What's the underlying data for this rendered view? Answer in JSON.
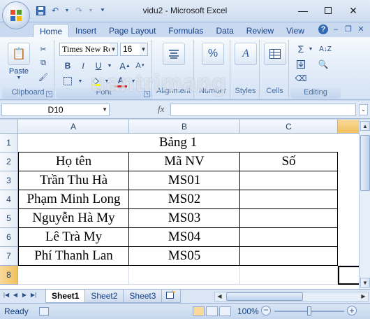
{
  "window": {
    "title": "vidu2 - Microsoft Excel"
  },
  "tabs": [
    "Home",
    "Insert",
    "Page Layout",
    "Formulas",
    "Data",
    "Review",
    "View"
  ],
  "ribbon": {
    "clipboard": {
      "label": "Clipboard",
      "paste": "Paste"
    },
    "font": {
      "label": "Font",
      "name": "Times New Ro",
      "size": "16",
      "bold": "B",
      "italic": "I",
      "underline": "U"
    },
    "alignment": {
      "label": "Alignment"
    },
    "number": {
      "label": "Number",
      "icon_text": "%"
    },
    "styles": {
      "label": "Styles"
    },
    "cells": {
      "label": "Cells"
    },
    "editing": {
      "label": "Editing",
      "sum": "Σ",
      "sort": "A↓Z"
    }
  },
  "formula_bar": {
    "name_box": "D10",
    "fx": "fx",
    "value": ""
  },
  "grid": {
    "columns": [
      "A",
      "B",
      "C"
    ],
    "rows": [
      "1",
      "2",
      "3",
      "4",
      "5",
      "6",
      "7",
      "8"
    ],
    "title": "Bảng 1",
    "headers": [
      "Họ tên",
      "Mã NV",
      "Số"
    ],
    "data": [
      [
        "Trần Thu Hà",
        "MS01",
        ""
      ],
      [
        "Phạm Minh Long",
        "MS02",
        ""
      ],
      [
        "Nguyễn Hà My",
        "MS03",
        ""
      ],
      [
        "Lê Trà My",
        "MS04",
        ""
      ],
      [
        "Phí Thanh Lan",
        "MS05",
        ""
      ]
    ]
  },
  "sheets": [
    "Sheet1",
    "Sheet2",
    "Sheet3"
  ],
  "active_sheet": "Sheet1",
  "status": {
    "text": "Ready",
    "zoom": "100%",
    "zoom_level": 1.0
  },
  "watermark": "uantrimang"
}
